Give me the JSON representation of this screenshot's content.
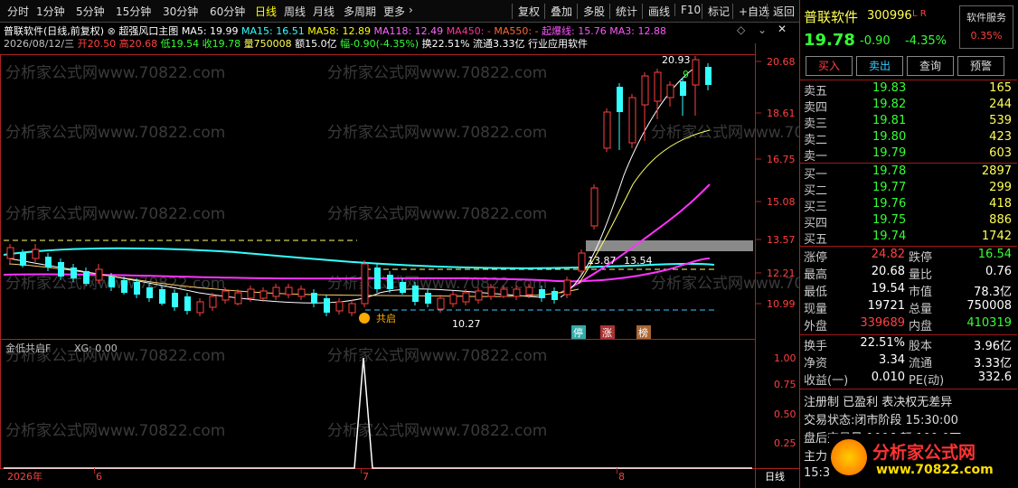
{
  "toolbar": {
    "periods": [
      "分时",
      "1分钟",
      "5分钟",
      "15分钟",
      "30分钟",
      "60分钟",
      "日线",
      "周线",
      "月线",
      "多周期",
      "更多"
    ],
    "active_period": "日线",
    "right_tools": [
      "复权",
      "叠加",
      "多股",
      "统计",
      "画线",
      "F10",
      "标记",
      "+自选",
      "返回"
    ]
  },
  "chart": {
    "header1": {
      "stock_title": "普联软件(日线,前复权)",
      "formula": "超强风口主图",
      "ma5": "MA5: 19.99",
      "ma15": "MA15: 16.51",
      "ma58": "MA58: 12.89",
      "ma118": "MA118: 12.49",
      "ma450": "MA450: -",
      "ma550": "MA550: -",
      "qibao": "起爆线: 15.76",
      "ma3": "MA3: 12.88"
    },
    "header2": {
      "date": "2026/08/12/三",
      "open": "开20.50",
      "high": "高20.68",
      "low": "低19.54",
      "close": "收19.78",
      "volume": "量750008",
      "amount": "额15.0亿",
      "change": "幅-0.90(-4.35%)",
      "turnover": "换22.51%",
      "float": "流通3.33亿",
      "industry": "行业应用软件"
    },
    "price_ticks": [
      "20.68",
      "18.61",
      "16.75",
      "15.08",
      "13.57",
      "12.21",
      "10.99"
    ],
    "annotations": {
      "top_price": "20.93",
      "nine": "9",
      "low_price": "10.27",
      "range_label": "13.54",
      "range_low": "13.54",
      "range_high": "13.87",
      "gonqi": "共启",
      "tag_stop": "停",
      "tag_rise": "涨",
      "tag_rank": "榜"
    },
    "sub_title": "金低共启F",
    "sub_xg": "XG: 0.00",
    "sub_ticks": [
      "1.00",
      "0.75",
      "0.50",
      "0.25"
    ],
    "date_labels": [
      "2026年",
      "6",
      "7",
      "8"
    ],
    "period_label": "日线",
    "watermark": "分析家公式网www.70822.com"
  },
  "panel": {
    "name": "普联软件",
    "code": "300996",
    "tag": "L R",
    "service": "软件服务",
    "service_pct": "0.35%",
    "price": "19.78",
    "chg": "-0.90",
    "chg_pct": "-4.35%",
    "buttons": [
      "买入",
      "卖出",
      "查询",
      "预警"
    ],
    "asks": [
      {
        "label": "卖五",
        "price": "19.83",
        "vol": "165"
      },
      {
        "label": "卖四",
        "price": "19.82",
        "vol": "244"
      },
      {
        "label": "卖三",
        "price": "19.81",
        "vol": "539"
      },
      {
        "label": "卖二",
        "price": "19.80",
        "vol": "423"
      },
      {
        "label": "卖一",
        "price": "19.79",
        "vol": "603"
      }
    ],
    "bids": [
      {
        "label": "买一",
        "price": "19.78",
        "vol": "2897"
      },
      {
        "label": "买二",
        "price": "19.77",
        "vol": "299"
      },
      {
        "label": "买三",
        "price": "19.76",
        "vol": "418"
      },
      {
        "label": "买四",
        "price": "19.75",
        "vol": "886"
      },
      {
        "label": "买五",
        "price": "19.74",
        "vol": "1742"
      }
    ],
    "stats": [
      {
        "l1": "涨停",
        "v1": "24.82",
        "l2": "跌停",
        "v2": "16.54"
      },
      {
        "l1": "最高",
        "v1": "20.68",
        "l2": "量比",
        "v2": "0.76"
      },
      {
        "l1": "最低",
        "v1": "19.54",
        "l2": "市值",
        "v2": "78.3亿"
      },
      {
        "l1": "现量",
        "v1": "19721",
        "l2": "总量",
        "v2": "750008"
      },
      {
        "l1": "外盘",
        "v1": "339689",
        "l2": "内盘",
        "v2": "410319"
      }
    ],
    "stats2": [
      {
        "l1": "换手",
        "v1": "22.51%",
        "l2": "股本",
        "v2": "3.96亿"
      },
      {
        "l1": "净资",
        "v1": "3.34",
        "l2": "流通",
        "v2": "3.33亿"
      },
      {
        "l1": "收益(一)",
        "v1": "0.010",
        "l2": "PE(动)",
        "v2": "332.6"
      }
    ],
    "info1": "注册制 已盈利 表决权无差异",
    "info2": "交易状态:闭市阶段 15:30:00",
    "info3": "盘后交易量:1006 额:199.0万",
    "info4": "主力",
    "time": "15:30",
    "logo_text": "分析家公式网",
    "logo_url": "www.70822.com"
  }
}
